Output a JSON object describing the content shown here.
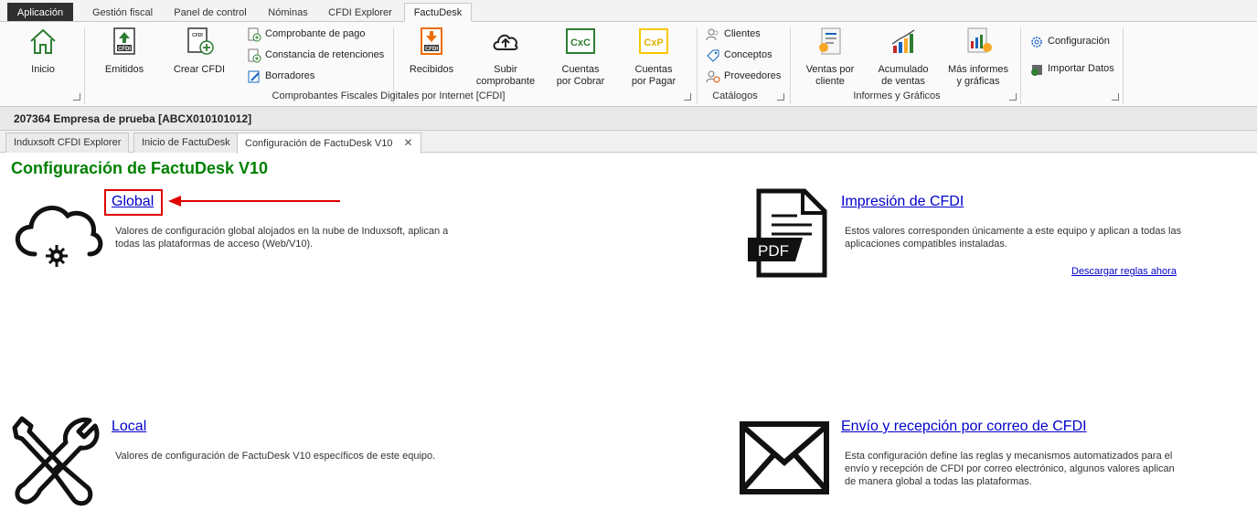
{
  "ribbon_tabs": [
    "Aplicación",
    "Gestión fiscal",
    "Panel de control",
    "Nóminas",
    "CFDI Explorer",
    "FactuDesk"
  ],
  "ribbon": {
    "inicio": "Inicio",
    "emitidos": "Emitidos",
    "crear_cfdi": "Crear CFDI",
    "comprobante_pago": "Comprobante de pago",
    "constancia_retenciones": "Constancia de retenciones",
    "borradores": "Borradores",
    "recibidos": "Recibidos",
    "subir_comprobante_1": "Subir",
    "subir_comprobante_2": "comprobante",
    "cxc_icon_text": "CxC",
    "cuentas_cobrar_1": "Cuentas",
    "cuentas_cobrar_2": "por Cobrar",
    "cxp_icon_text": "CxP",
    "cuentas_pagar_1": "Cuentas",
    "cuentas_pagar_2": "por Pagar",
    "clientes": "Clientes",
    "conceptos": "Conceptos",
    "proveedores": "Proveedores",
    "ventas_cliente_1": "Ventas por",
    "ventas_cliente_2": "cliente",
    "acumulado_1": "Acumulado",
    "acumulado_2": "de ventas",
    "mas_informes_1": "Más informes",
    "mas_informes_2": "y gráficas",
    "configuracion": "Configuración",
    "importar_datos": "Importar Datos",
    "group_cfdi": "Comprobantes Fiscales Digitales por Internet [CFDI]",
    "group_catalogos": "Catálogos",
    "group_informes": "Informes y Gráficos",
    "cfdi_icon_text": "CFDI"
  },
  "company_bar": "207364 Empresa de prueba [ABCX010101012]",
  "doc_tabs": [
    "Induxsoft CFDI Explorer",
    "Inicio de FactuDesk",
    "Configuración de FactuDesk V10"
  ],
  "close_glyph": "✕",
  "page_title": "Configuración de FactuDesk V10",
  "cards": {
    "global": {
      "title": "Global",
      "desc_1": "Valores de configuración global alojados en la nube de Induxsoft, aplican a",
      "desc_2": "todas las plataformas de acceso (Web/V10)."
    },
    "impresion": {
      "title": "Impresión de CFDI",
      "desc_1": "Estos valores corresponden únicamente a este equipo y aplican a todas las",
      "desc_2": "aplicaciones compatibles instaladas.",
      "link": "Descargar reglas ahora",
      "icon_text": "PDF"
    },
    "local": {
      "title": "Local",
      "desc_1": "Valores de configuración de FactuDesk V10 específicos de este equipo."
    },
    "correo": {
      "title": "Envío y recepción por correo de CFDI",
      "desc_1": "Esta configuración define las reglas y mecanismos automatizados para el",
      "desc_2": "envío y recepción de CFDI por correo electrónico, algunos valores aplican",
      "desc_3": "de manera global a todas las plataformas."
    }
  },
  "colors": {
    "title_green": "#008000",
    "link_blue": "#0000cc",
    "highlight_red": "#e00000"
  }
}
